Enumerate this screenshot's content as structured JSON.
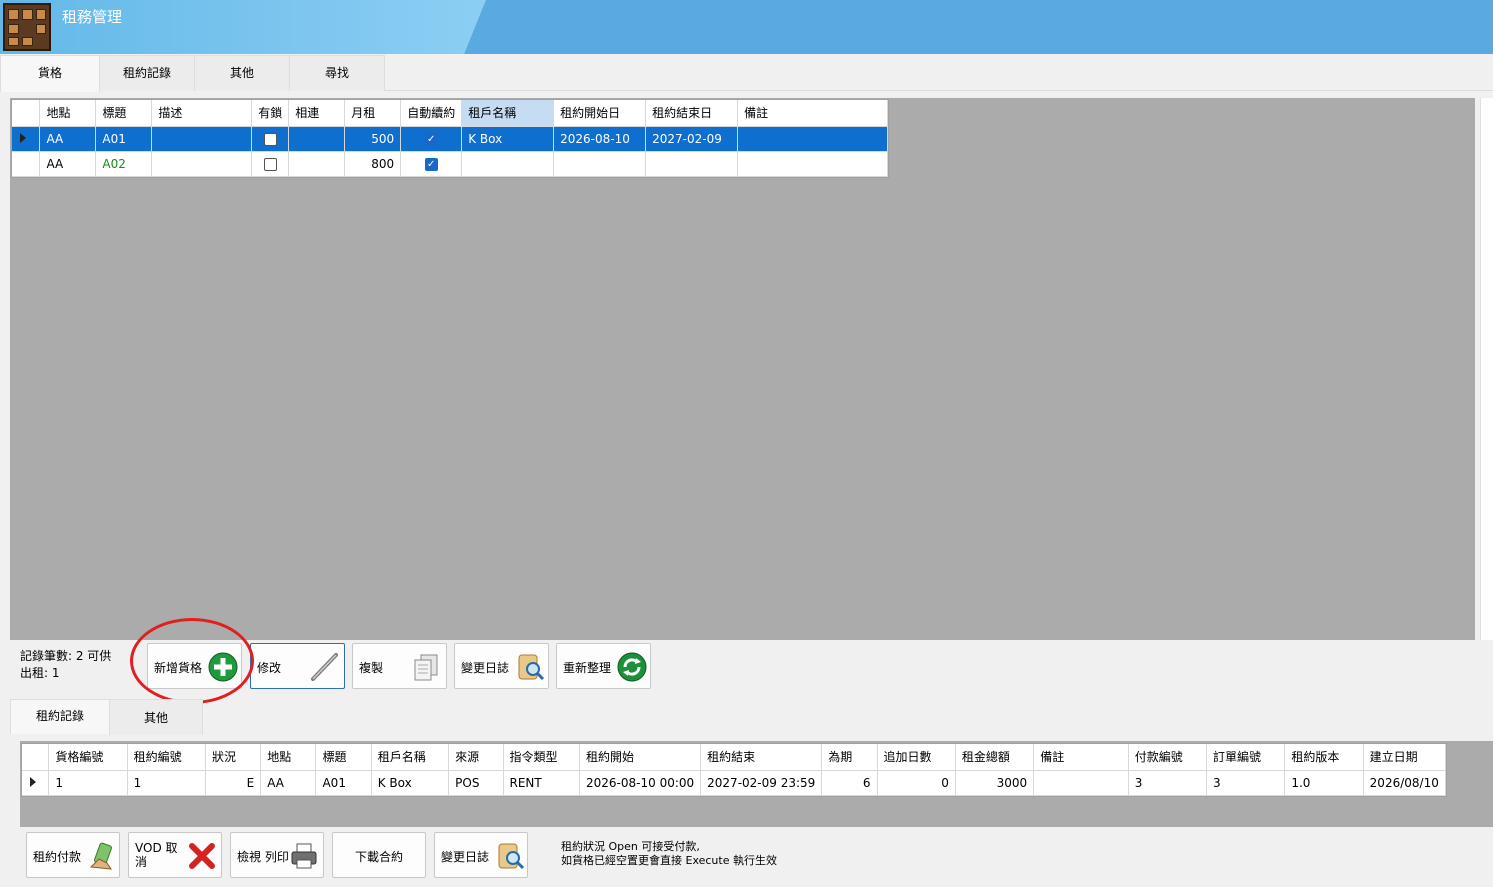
{
  "app": {
    "title": "租務管理"
  },
  "main_tabs": [
    {
      "label": "貨格"
    },
    {
      "label": "租約記錄"
    },
    {
      "label": "其他"
    },
    {
      "label": "尋找"
    }
  ],
  "units_grid": {
    "columns": [
      "地點",
      "標題",
      "描述",
      "有鎖",
      "相連",
      "月租",
      "自動續約",
      "租戶名稱",
      "租約開始日",
      "租約結束日",
      "備註"
    ],
    "rows": [
      {
        "location": "AA",
        "title": "A01",
        "desc": "",
        "locked": false,
        "linked": "",
        "rent": "500",
        "auto_renew": true,
        "tenant": "K Box",
        "start": "2026-08-10",
        "end": "2027-02-09",
        "note": "",
        "selected": true
      },
      {
        "location": "AA",
        "title": "A02",
        "desc": "",
        "locked": false,
        "linked": "",
        "rent": "800",
        "auto_renew": true,
        "tenant": "",
        "start": "",
        "end": "",
        "note": "",
        "selected": false
      }
    ]
  },
  "status": {
    "line1": "記錄筆數: 2   可供",
    "line2": "出租: 1"
  },
  "toolbar1": {
    "add_label": "新增貨格",
    "edit_label": "修改",
    "copy_label": "複製",
    "log_label": "變更日誌",
    "refresh_label": "重新整理"
  },
  "sub_tabs": [
    {
      "label": "租約記錄"
    },
    {
      "label": "其他"
    }
  ],
  "lease_grid": {
    "columns": [
      "貨格編號",
      "租約編號",
      "狀況",
      "地點",
      "標題",
      "租戶名稱",
      "來源",
      "指令類型",
      "租約開始",
      "租約結束",
      "為期",
      "追加日數",
      "租金總額",
      "備註",
      "付款編號",
      "訂單編號",
      "租約版本",
      "建立日期"
    ],
    "rows": [
      {
        "unit_no": "1",
        "lease_no": "1",
        "status": "E",
        "location": "AA",
        "title": "A01",
        "tenant": "K Box",
        "source": "POS",
        "cmd": "RENT",
        "start": "2026-08-10 00:00",
        "end": "2027-02-09 23:59",
        "period": "6",
        "extra_days": "0",
        "total": "3000",
        "note": "",
        "pay_no": "3",
        "order_no": "3",
        "version": "1.0",
        "created": "2026/08/10"
      }
    ]
  },
  "toolbar2": {
    "pay_label": "租約付款",
    "void_label": "VOD 取消",
    "print_label": "檢視 列印",
    "download_label": "下載合約",
    "log_label": "變更日誌"
  },
  "hint": {
    "line1": "租約狀況 Open 可接受付款,",
    "line2": "如貨格已經空置更會直接 Execute 執行生效"
  }
}
